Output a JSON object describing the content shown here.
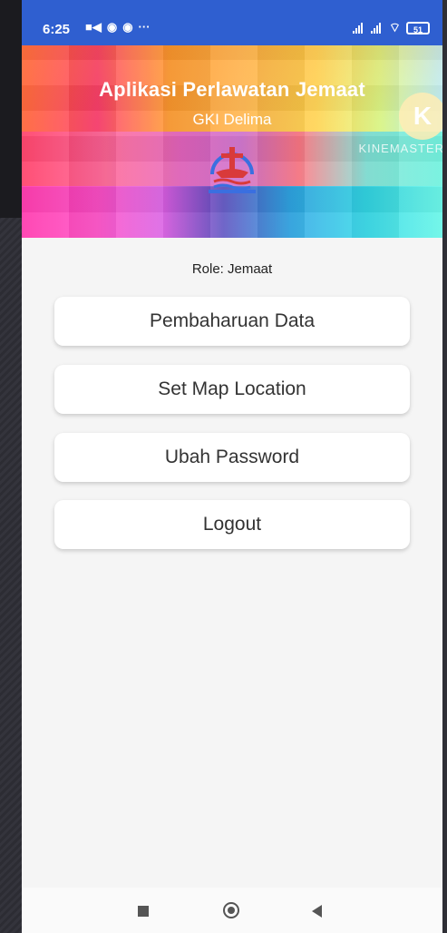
{
  "status_bar": {
    "time": "6:25",
    "dots": "···",
    "battery": "51"
  },
  "header": {
    "title": "Aplikasi Perlawatan Jemaat",
    "subtitle": "GKI Delima",
    "watermark": "KINEMASTER",
    "watermark_badge": "K"
  },
  "main": {
    "role": "Role: Jemaat",
    "buttons": [
      {
        "label": "Pembaharuan Data"
      },
      {
        "label": "Set Map Location"
      },
      {
        "label": "Ubah Password"
      },
      {
        "label": "Logout"
      }
    ]
  },
  "colors": {
    "status_bar": "#2f5fd0",
    "background": "#f5f5f5",
    "button": "#ffffff",
    "logo_cross": "#d93a3a",
    "logo_ring": "#3a6fe0"
  },
  "icons": [
    "video-icon",
    "chrome-icon",
    "signal-icon",
    "wifi-icon",
    "battery-icon",
    "church-logo-icon",
    "recents-icon",
    "home-icon",
    "back-icon"
  ]
}
